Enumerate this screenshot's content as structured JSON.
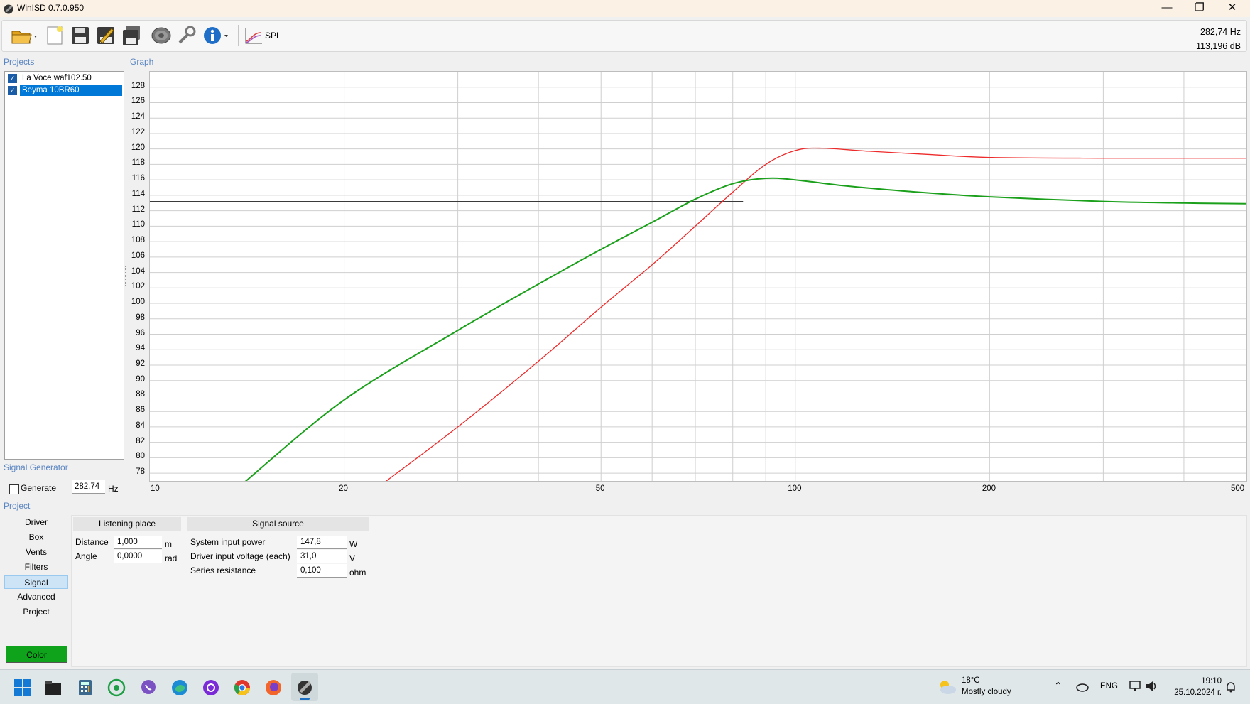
{
  "window": {
    "title": "WinISD 0.7.0.950",
    "minimize": "—",
    "maximize": "❐",
    "close": "✕"
  },
  "toolbar": {
    "spl_label": "SPL",
    "readout_freq": "282,74 Hz",
    "readout_db": "113,196 dB"
  },
  "projects": {
    "label": "Projects",
    "items": [
      {
        "name": "La Voce waf102.50",
        "checked": true,
        "selected": false
      },
      {
        "name": "Beyma 10BR60",
        "checked": true,
        "selected": true
      }
    ]
  },
  "graph": {
    "label": "Graph"
  },
  "chart_data": {
    "type": "line",
    "xscale": "log",
    "xlim": [
      10,
      500
    ],
    "ylim": [
      77,
      130
    ],
    "xticks": [
      "10",
      "20",
      "50",
      "100",
      "200",
      "500"
    ],
    "yticks": [
      "128",
      "126",
      "124",
      "122",
      "120",
      "118",
      "116",
      "114",
      "112",
      "110",
      "108",
      "106",
      "104",
      "102",
      "100",
      "98",
      "96",
      "94",
      "92",
      "90",
      "88",
      "86",
      "84",
      "82",
      "80",
      "78"
    ],
    "grid": true,
    "series": [
      {
        "color": "#ee2b2b",
        "x": [
          23,
          30,
          40,
          50,
          60,
          70,
          80,
          90,
          100,
          110,
          130,
          160,
          200,
          300,
          400,
          500
        ],
        "y": [
          76.7,
          84.0,
          92.5,
          99.5,
          105.0,
          110.0,
          114.4,
          118.0,
          119.8,
          120.1,
          119.7,
          119.3,
          118.9,
          118.8,
          118.8,
          118.8
        ]
      },
      {
        "color": "#1aa01a",
        "x": [
          14,
          20,
          30,
          40,
          50,
          60,
          70,
          80,
          90,
          100,
          120,
          150,
          200,
          300,
          400,
          500
        ],
        "y": [
          76.8,
          87.5,
          96.5,
          102.5,
          107.0,
          110.5,
          113.5,
          115.5,
          116.2,
          116.0,
          115.2,
          114.5,
          113.8,
          113.2,
          113.0,
          112.9
        ]
      }
    ],
    "cursor_db": 113.196,
    "cursor_line_color": "#3a3a3a"
  },
  "signal_generator": {
    "label": "Signal Generator",
    "generate_label": "Generate",
    "generate_checked": false,
    "freq_value": "282,74",
    "freq_unit": "Hz"
  },
  "project_nav": {
    "label": "Project",
    "items": [
      "Driver",
      "Box",
      "Vents",
      "Filters",
      "Signal",
      "Advanced",
      "Project"
    ],
    "active": "Signal",
    "color_button": "Color",
    "color": "#0ea31a"
  },
  "listening_place": {
    "header": "Listening place",
    "distance_label": "Distance",
    "distance_value": "1,000",
    "distance_unit": "m",
    "angle_label": "Angle",
    "angle_value": "0,0000",
    "angle_unit": "rad"
  },
  "signal_source": {
    "header": "Signal source",
    "power_label": "System input power",
    "power_value": "147,8",
    "power_unit": "W",
    "voltage_label": "Driver input voltage (each)",
    "voltage_value": "31,0",
    "voltage_unit": "V",
    "resistance_label": "Series resistance",
    "resistance_value": "0,100",
    "resistance_unit": "ohm"
  },
  "taskbar": {
    "weather_temp": "18°C",
    "weather_desc": "Mostly cloudy",
    "language": "ENG",
    "time": "19:10",
    "date": "25.10.2024 г."
  }
}
